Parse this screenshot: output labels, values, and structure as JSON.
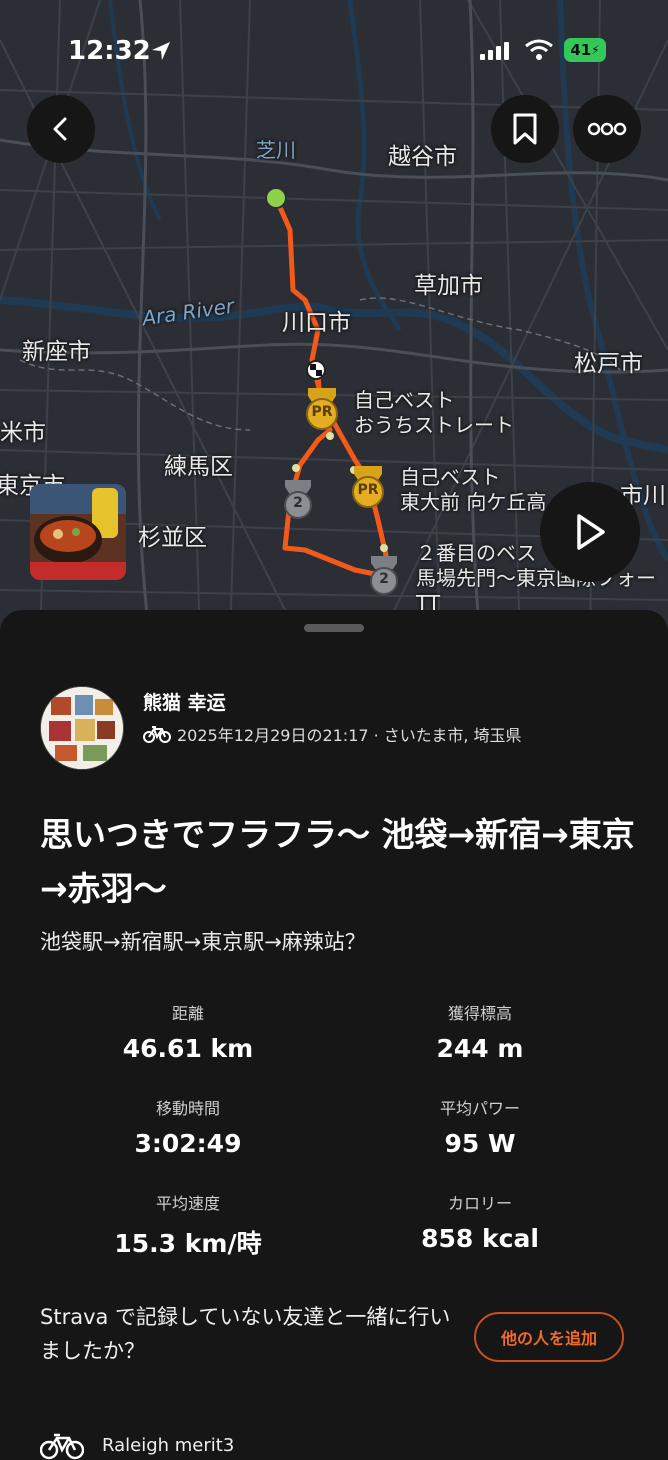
{
  "status_bar": {
    "time": "12:32",
    "battery": "41"
  },
  "map": {
    "labels": {
      "koshigaya": "越谷市",
      "soka": "草加市",
      "kawaguchi": "川口市",
      "niiza": "新座市",
      "matsudo": "松戸市",
      "ara_river": "Ara River",
      "kome": "米市",
      "nerima": "練馬区",
      "higashikurume": "東京市",
      "suginami": "杉並区",
      "ichikawa": "市川",
      "shiba": "芝川"
    },
    "segments": {
      "pr1_line1": "自己ベスト",
      "pr1_line2": "おうちストレート",
      "pr2_line1": "自己ベスト",
      "pr2_line2": "東大前 向ケ丘高",
      "second_line1": "２番目のベス",
      "second_line2": "馬場先門〜東京国際フォー",
      "second_line3": "TT",
      "badge_pr": "PR",
      "badge_2": "2"
    }
  },
  "activity": {
    "athlete_name": "熊猫 幸运",
    "meta": "2025年12月29日の21:17 · さいたま市, 埼玉県",
    "title": "思いつきでフラフラ〜 池袋→新宿→東京→赤羽〜",
    "description": "池袋駅→新宿駅→東京駅→麻辣站？",
    "stats": [
      {
        "label": "距離",
        "value": "46.61 km"
      },
      {
        "label": "獲得標高",
        "value": "244 m"
      },
      {
        "label": "移動時間",
        "value": "3:02:49"
      },
      {
        "label": "平均パワー",
        "value": "95 W"
      },
      {
        "label": "平均速度",
        "value": "15.3 km/時"
      },
      {
        "label": "カロリー",
        "value": "858 kcal"
      }
    ],
    "friend_prompt": "Strava で記録していない友達と一緒に行いましたか？",
    "add_people_button": "他の人を追加",
    "gear": "Raleigh merit3"
  },
  "colors": {
    "accent": "#fc4c02",
    "route": "#f25a1c",
    "pr_badge": "#d9a21b",
    "second_badge": "#8b8f94"
  }
}
